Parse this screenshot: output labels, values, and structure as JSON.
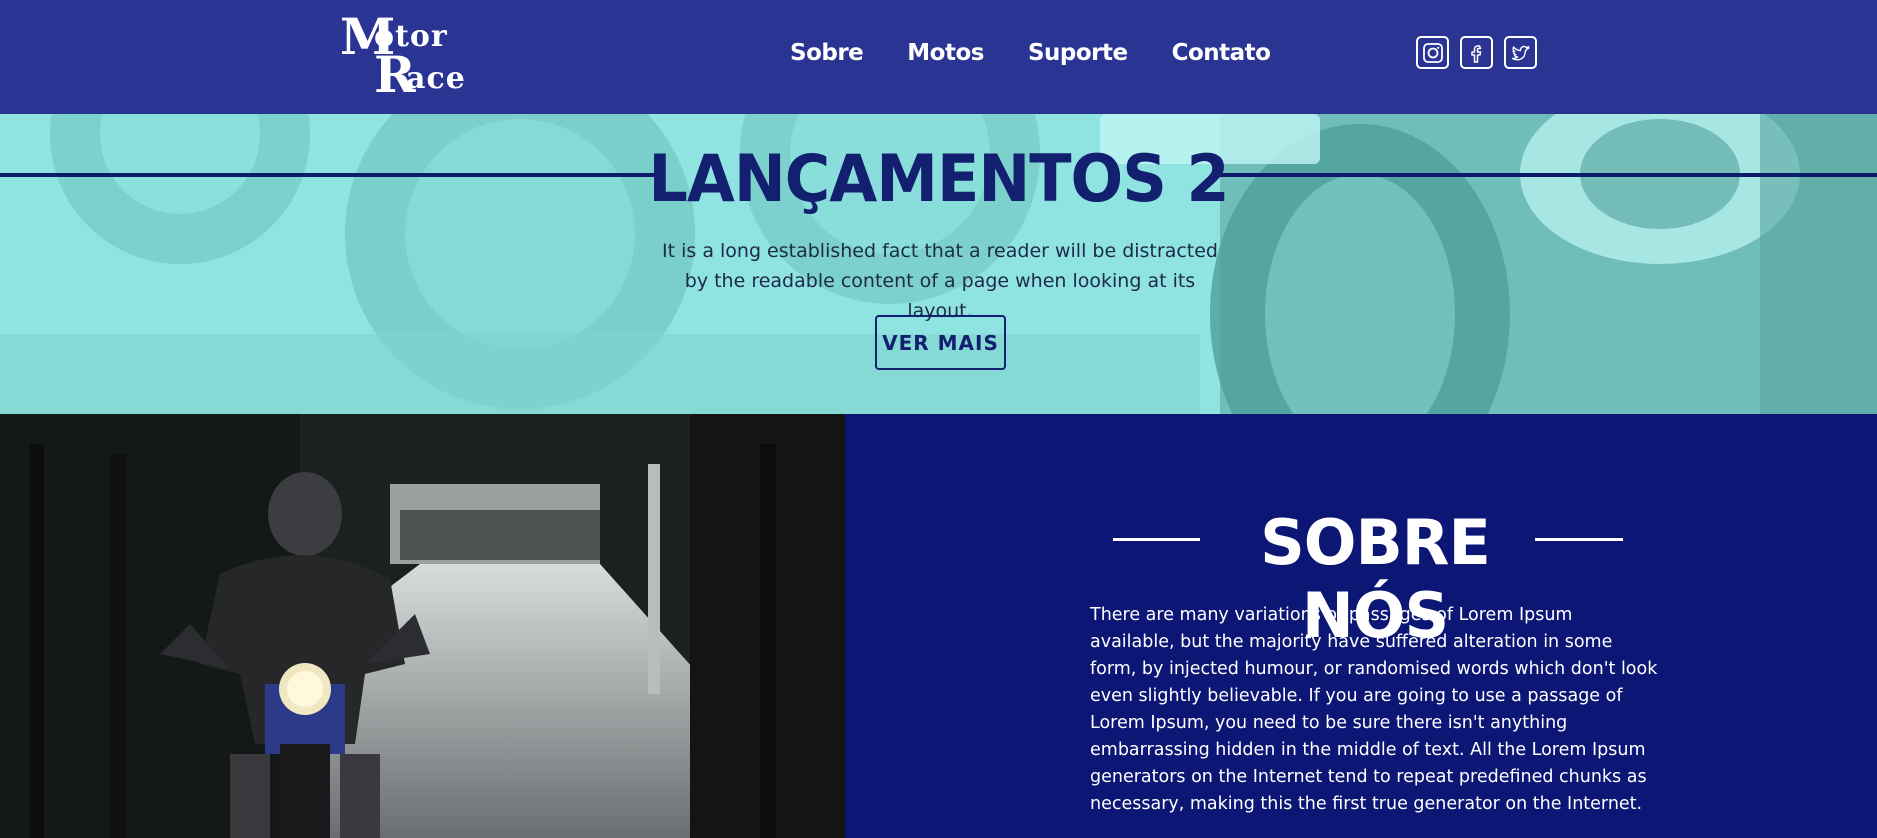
{
  "header": {
    "logo": {
      "part1": "M",
      "part2": "otor",
      "part3": "R",
      "part4": "ace"
    },
    "nav": [
      {
        "label": "Sobre"
      },
      {
        "label": "Motos"
      },
      {
        "label": "Suporte"
      },
      {
        "label": "Contato"
      }
    ],
    "socials": [
      {
        "icon": "instagram-icon"
      },
      {
        "icon": "facebook-icon"
      },
      {
        "icon": "twitter-icon"
      }
    ]
  },
  "banner": {
    "title": "LANÇAMENTOS 2",
    "text": "It is a long established fact that a reader will be distracted by the readable content of a page when looking at its layout.",
    "button_label": "VER MAIS"
  },
  "about": {
    "title": "SOBRE NÓS",
    "text": "There are many variations of passages of Lorem Ipsum available, but the majority have suffered alteration in some form, by injected humour, or randomised words which don't look even slightly believable. If you are going to use a passage of Lorem Ipsum, you need to be sure there isn't anything embarrassing hidden in the middle of text. All the Lorem Ipsum generators on the Internet tend to repeat predefined chunks as necessary, making this the first true generator on the Internet."
  },
  "colors": {
    "header_bg": "#2a3493",
    "banner_bg": "#8fe3e0",
    "accent_navy": "#0b1675",
    "text_white": "#ffffff"
  }
}
